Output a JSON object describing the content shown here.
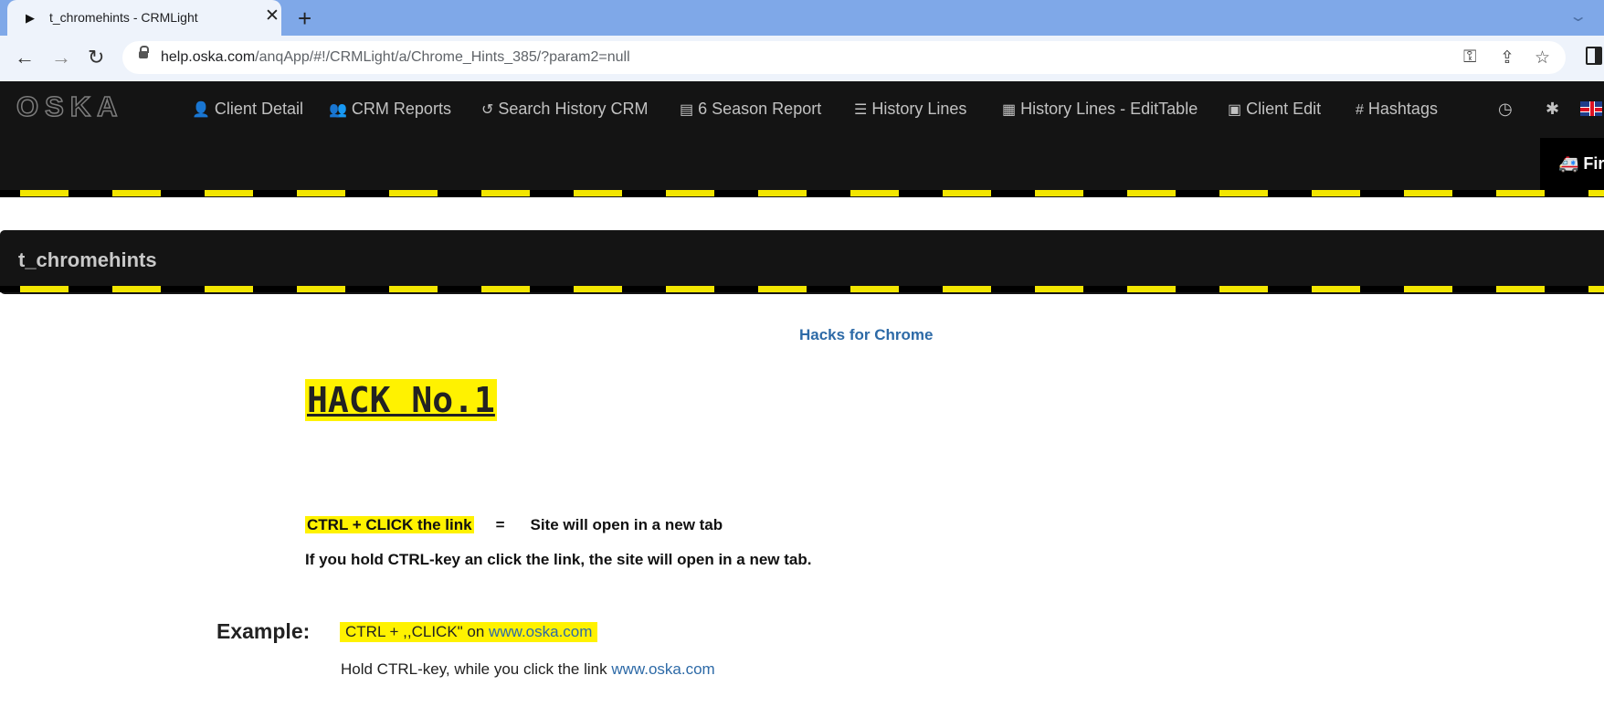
{
  "browser": {
    "tab_icon": "▶",
    "tab_title": "t_chromehints - CRMLight",
    "tab_close": "✕",
    "new_tab": "+",
    "tab_menu": "⌄",
    "back": "←",
    "forward": "→",
    "reload": "↻",
    "url_host": "help.oska.com",
    "url_rest": "/anqApp/#!/CRMLight/a/Chrome_Hints_385/?param2=null",
    "key_icon": "⚿",
    "share_icon": "⇪",
    "star_icon": "☆"
  },
  "app_nav": {
    "logo": "OSKA",
    "items": [
      {
        "icon": "👤",
        "label": "Client Detail"
      },
      {
        "icon": "👥",
        "label": "CRM Reports"
      },
      {
        "icon": "↺",
        "label": "Search History CRM"
      },
      {
        "icon": "▤",
        "label": "6 Season Report"
      },
      {
        "icon": "☰",
        "label": "History Lines"
      },
      {
        "icon": "▦",
        "label": "History Lines - EditTable"
      },
      {
        "icon": "▣",
        "label": "Client Edit"
      },
      {
        "icon": "#",
        "label": "Hashtags"
      }
    ],
    "clock_icon": "◷",
    "bug_icon": "✱",
    "first_button": "🚑 Firs"
  },
  "page": {
    "title": "t_chromehints",
    "subtitle": "Hacks for Chrome",
    "hack_heading": "HACK No.1",
    "shortcut": "CTRL + CLICK the link",
    "equals": "=",
    "result": "Site will open in a new tab",
    "explanation": "If you hold CTRL-key an click the link, the site will open in a new tab.",
    "example_label": "Example:",
    "example_prefix": "CTRL + ,,CLICK\" on ",
    "example_link": "www.oska.com",
    "example_line2_prefix": "Hold CTRL-key, while you click the link ",
    "example_line2_link": "www.oska.com"
  },
  "colors": {
    "nav_bg": "#141414",
    "stripe_yellow": "#f3e600",
    "highlight": "#fff200",
    "link": "#2d6aa7"
  }
}
